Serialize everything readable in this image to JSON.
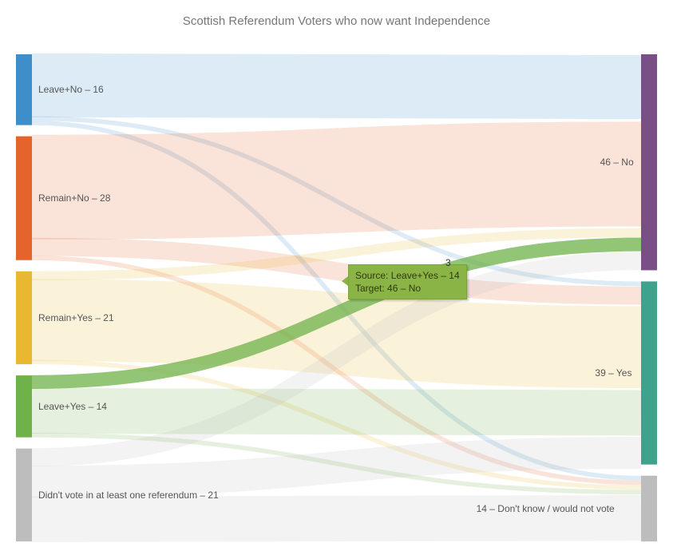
{
  "title": "Scottish Referendum Voters who now want Independence",
  "chart_data": {
    "type": "sankey",
    "source_nodes": [
      {
        "id": "leave_no",
        "label": "Leave+No – 16",
        "value": 16,
        "color": "#3d8ec9"
      },
      {
        "id": "remain_no",
        "label": "Remain+No – 28",
        "value": 28,
        "color": "#e5642b"
      },
      {
        "id": "remain_yes",
        "label": "Remain+Yes – 21",
        "value": 21,
        "color": "#e8b833"
      },
      {
        "id": "leave_yes",
        "label": "Leave+Yes – 14",
        "value": 14,
        "color": "#6fb24a"
      },
      {
        "id": "novote",
        "label": "Didn't vote in at least one referendum – 21",
        "value": 21,
        "color": "#bdbdbd"
      }
    ],
    "target_nodes": [
      {
        "id": "no",
        "label": "46 – No",
        "value": 46,
        "color": "#7a4f88"
      },
      {
        "id": "yes",
        "label": "39 – Yes",
        "value": 39,
        "color": "#3fa28c"
      },
      {
        "id": "dk",
        "label": "14 – Don't know / would not vote",
        "value": 14,
        "color": "#bdbdbd"
      }
    ],
    "links": [
      {
        "source": "leave_no",
        "target": "no",
        "value": 14,
        "color": "#3d8ec9"
      },
      {
        "source": "leave_no",
        "target": "yes",
        "value": 1,
        "color": "#3d8ec9"
      },
      {
        "source": "leave_no",
        "target": "dk",
        "value": 1,
        "color": "#3d8ec9"
      },
      {
        "source": "remain_no",
        "target": "no",
        "value": 23,
        "color": "#e5642b"
      },
      {
        "source": "remain_no",
        "target": "yes",
        "value": 4,
        "color": "#e5642b"
      },
      {
        "source": "remain_no",
        "target": "dk",
        "value": 1,
        "color": "#e5642b"
      },
      {
        "source": "remain_yes",
        "target": "no",
        "value": 2,
        "color": "#e8b833"
      },
      {
        "source": "remain_yes",
        "target": "yes",
        "value": 18,
        "color": "#e8b833"
      },
      {
        "source": "remain_yes",
        "target": "dk",
        "value": 1,
        "color": "#e8b833"
      },
      {
        "source": "leave_yes",
        "target": "no",
        "value": 3,
        "color": "#6fb24a"
      },
      {
        "source": "leave_yes",
        "target": "yes",
        "value": 10,
        "color": "#6fb24a"
      },
      {
        "source": "leave_yes",
        "target": "dk",
        "value": 1,
        "color": "#6fb24a"
      },
      {
        "source": "novote",
        "target": "no",
        "value": 4,
        "color": "#bdbdbd"
      },
      {
        "source": "novote",
        "target": "yes",
        "value": 7,
        "color": "#bdbdbd"
      },
      {
        "source": "novote",
        "target": "dk",
        "value": 10,
        "color": "#bdbdbd"
      }
    ],
    "tooltip": {
      "source_line": "Source: Leave+Yes – 14",
      "target_line": "Target: 46 – No",
      "value": "3"
    }
  }
}
